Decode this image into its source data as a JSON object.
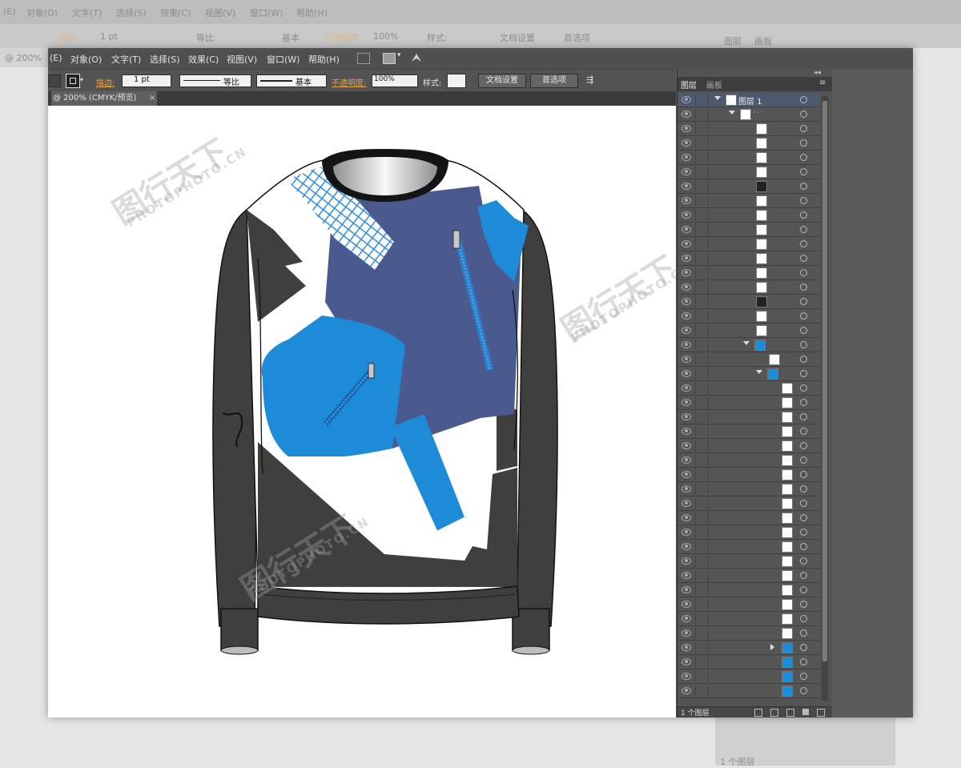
{
  "background_window": {
    "menu": [
      "(E)",
      "对象(O)",
      "文字(T)",
      "选择(S)",
      "效果(C)",
      "视图(V)",
      "窗口(W)",
      "帮助(H)"
    ],
    "stroke_label": "描边:",
    "stroke_value": "1 pt",
    "profile": "等比",
    "brush": "基本",
    "opacity_label": "不透明度",
    "opacity_value": "100%",
    "style_label": "样式:",
    "doc_settings": "文档设置",
    "preferences": "首选项",
    "zoom_tab": "@ 200%",
    "panel_tabs": [
      "图层",
      "画板"
    ],
    "layer_count": "1 个图层"
  },
  "menubar": {
    "items": [
      "(E)",
      "对象(O)",
      "文字(T)",
      "选择(S)",
      "效果(C)",
      "视图(V)",
      "窗口(W)",
      "帮助(H)"
    ]
  },
  "control_bar": {
    "stroke_label": "描边:",
    "stroke_value": "1 pt",
    "profile_label": "等比",
    "brush_label": "基本",
    "opacity_label": "不透明度:",
    "opacity_value": "100%",
    "style_label": "样式:",
    "doc_settings_button": "文档设置",
    "preferences_button": "首选项"
  },
  "document_tab": {
    "label": "@ 200% (CMYK/预览)",
    "close": "×"
  },
  "layers_panel": {
    "tabs": [
      "图层",
      "画板"
    ],
    "layer_name": "图层 1",
    "layer_count": "1 个图层",
    "sublayer_label": "· · ·"
  },
  "watermark": {
    "logo_text": "图行天下",
    "url_text": "PHOTOPHOTO.CN"
  },
  "colors": {
    "app_dark": "#535353",
    "canvas": "#ffffff",
    "shirt_dark": "#3f403d",
    "navy": "#4a5a8e",
    "bright_blue": "#1e8bd8",
    "collar": "#141414"
  }
}
